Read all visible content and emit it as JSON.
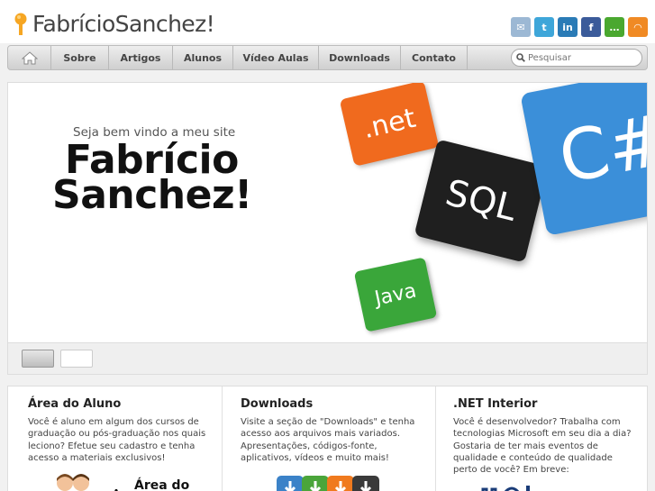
{
  "site": {
    "title": "FabrícioSanchez!"
  },
  "social_icons": [
    {
      "name": "email-icon",
      "color": "#9cb8d4",
      "glyph": "✉"
    },
    {
      "name": "twitter-icon",
      "color": "#3ea6d9",
      "glyph": "t"
    },
    {
      "name": "linkedin-icon",
      "color": "#2a7bb6",
      "glyph": "in"
    },
    {
      "name": "facebook-icon",
      "color": "#3b5b9a",
      "glyph": "f"
    },
    {
      "name": "chat-icon",
      "color": "#4aa82f",
      "glyph": "…"
    },
    {
      "name": "rss-icon",
      "color": "#f08a24",
      "glyph": "◠"
    }
  ],
  "nav": {
    "items": [
      "Sobre",
      "Artigos",
      "Alunos",
      "Vídeo Aulas",
      "Downloads",
      "Contato"
    ],
    "search_placeholder": "Pesquisar"
  },
  "banner": {
    "welcome": "Seja bem vindo a meu site",
    "name_line1": "Fabrício",
    "name_line2": "Sanchez!",
    "tiles": [
      ".net",
      "SQL",
      "C#",
      "Java"
    ],
    "tile_colors": {
      "net": "#f06a1e",
      "sql": "#1f1f1f",
      "csharp": "#3b8fd9",
      "java": "#3aa63a"
    }
  },
  "cards": [
    {
      "title": "Área do Aluno",
      "text": "Você é aluno em algum dos cursos de graduação ou pós-graduação nos quais leciono? Efetue seu cadastro e tenha acesso a materiais exclusivos!",
      "image_caption": "Área do"
    },
    {
      "title": "Downloads",
      "text": "Visite a seção de \"Downloads\" e tenha acesso aos arquivos mais variados. Apresentações, códigos-fonte, aplicativos, vídeos e muito mais!"
    },
    {
      "title": ".NET Interior",
      "text": "Você é desenvolvedor? Trabalha com tecnologias Microsoft em seu dia a dia? Gostaria de ter mais eventos de qualidade e conteúdo de qualidade perto de você? Em breve:"
    }
  ]
}
